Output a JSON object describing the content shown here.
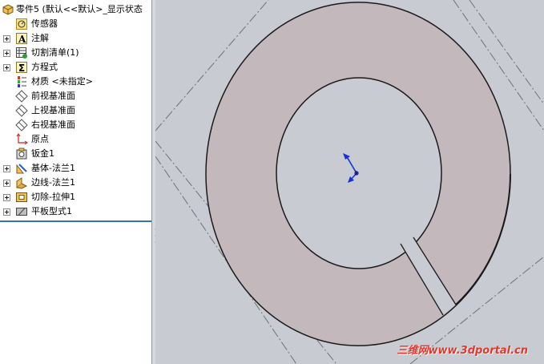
{
  "feature_tree": {
    "root": {
      "label": "零件5 (默认<<默认>_显示状态",
      "icon": "part-icon"
    },
    "items": [
      {
        "label": "传感器",
        "icon": "sensor-icon",
        "expandable": false
      },
      {
        "label": "注解",
        "icon": "annotation-icon",
        "expandable": true
      },
      {
        "label": "切割清单(1)",
        "icon": "cut-list-icon",
        "expandable": true
      },
      {
        "label": "方程式",
        "icon": "equation-icon",
        "expandable": true
      },
      {
        "label": "材质 <未指定>",
        "icon": "material-icon",
        "expandable": false
      },
      {
        "label": "前视基准面",
        "icon": "plane-icon",
        "expandable": false
      },
      {
        "label": "上视基准面",
        "icon": "plane-icon",
        "expandable": false
      },
      {
        "label": "右视基准面",
        "icon": "plane-icon",
        "expandable": false
      },
      {
        "label": "原点",
        "icon": "origin-icon",
        "expandable": false
      },
      {
        "label": "钣金1",
        "icon": "sheet-metal-icon",
        "expandable": false
      },
      {
        "label": "基体-法兰1",
        "icon": "base-flange-icon",
        "expandable": true
      },
      {
        "label": "边线-法兰1",
        "icon": "edge-flange-icon",
        "expandable": true
      },
      {
        "label": "切除-拉伸1",
        "icon": "cut-extrude-icon",
        "expandable": true
      },
      {
        "label": "平板型式1",
        "icon": "flat-pattern-icon",
        "expandable": true
      }
    ]
  },
  "splitter": {
    "grip": "◂◂◂"
  },
  "graphics": {
    "watermark": "三维网www.3dportal.cn",
    "colors": {
      "part_face": "#c3b9bc",
      "background": "#c8cbd2",
      "edge": "#1a1a1a",
      "triad_blue": "#1431d6"
    }
  }
}
